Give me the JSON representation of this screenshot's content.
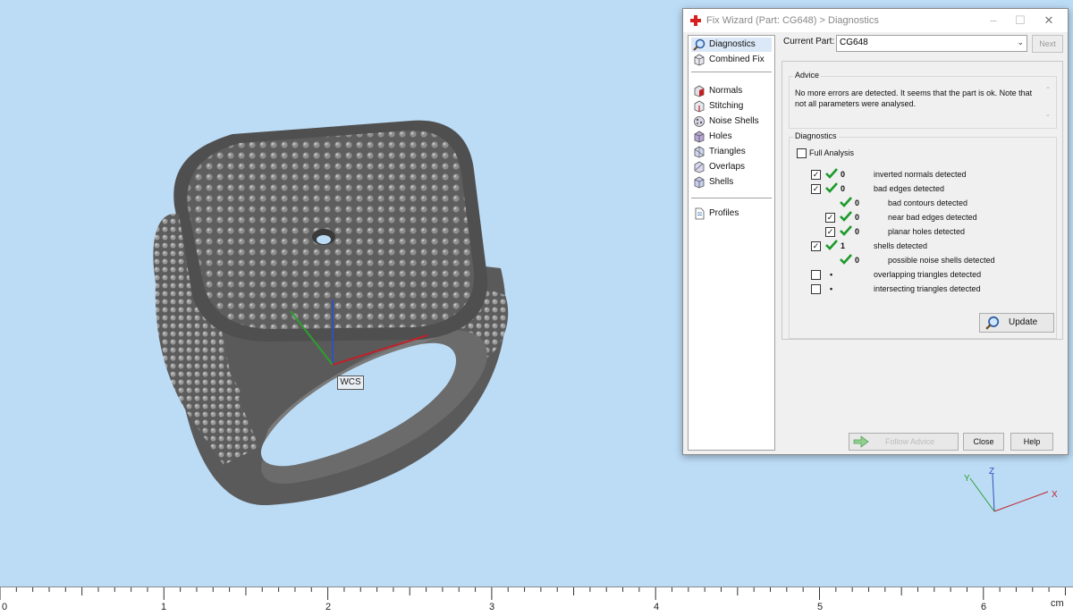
{
  "viewport": {
    "wcs_label": "WCS",
    "axis_labels": {
      "z": "Z",
      "x": "X",
      "y": "Y"
    },
    "axis_colors": {
      "x": "#c0202a",
      "y": "#2ca02c",
      "z": "#3050c0"
    }
  },
  "ruler": {
    "ticks": [
      "0",
      "1",
      "2",
      "3",
      "4",
      "5",
      "6"
    ],
    "unit": "cm"
  },
  "dialog": {
    "title": "Fix Wizard (Part: CG648) > Diagnostics",
    "nav": {
      "diagnostics": "Diagnostics",
      "combined_fix": "Combined Fix",
      "normals": "Normals",
      "stitching": "Stitching",
      "noise_shells": "Noise Shells",
      "holes": "Holes",
      "triangles": "Triangles",
      "overlaps": "Overlaps",
      "shells": "Shells",
      "profiles": "Profiles"
    },
    "current_part_label": "Current Part:",
    "current_part_value": "CG648",
    "next_label": "Next",
    "advice": {
      "title": "Advice",
      "text": "No more errors are detected. It seems that the part is ok. Note that not all parameters were analysed."
    },
    "diagnostics": {
      "title": "Diagnostics",
      "full_analysis_label": "Full Analysis",
      "rows": [
        {
          "count": "0",
          "label": "inverted normals detected",
          "checked": true
        },
        {
          "count": "0",
          "label": "bad edges detected",
          "checked": true
        },
        {
          "count": "0",
          "label": "bad contours detected"
        },
        {
          "count": "0",
          "label": "near bad edges detected",
          "checked": true
        },
        {
          "count": "0",
          "label": "planar holes detected",
          "checked": true
        },
        {
          "count": "1",
          "label": "shells detected",
          "checked": true
        },
        {
          "count": "0",
          "label": "possible noise shells detected"
        },
        {
          "count": "•",
          "label": "overlapping triangles detected",
          "checked": false
        },
        {
          "count": "•",
          "label": "intersecting triangles detected",
          "checked": false
        }
      ],
      "update_label": "Update"
    },
    "buttons": {
      "follow_advice": "Follow Advice",
      "close": "Close",
      "help": "Help"
    },
    "colors": {
      "check_green": "#1a9a2a",
      "selected_bg": "#dbe8f7"
    }
  }
}
